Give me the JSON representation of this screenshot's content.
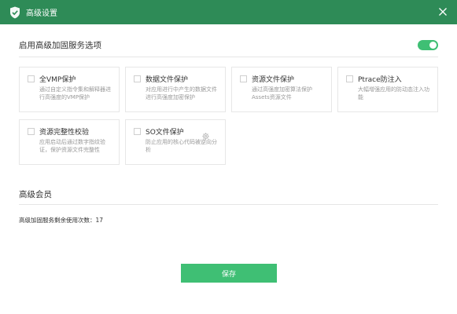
{
  "window": {
    "title": "高级设置",
    "title_color": "#2e8b57",
    "accent_color": "#3fbf74",
    "icon": "shield-check-icon",
    "close_icon": "close-icon"
  },
  "reinforce": {
    "header": "启用高级加固服务选项",
    "toggle_on": true,
    "options": [
      {
        "name": "全VMP保护",
        "desc": "通过自定义指令集和解释器进行高强度的VMP保护",
        "checked": false
      },
      {
        "name": "数据文件保护",
        "desc": "对应用进行中产生的数据文件进行高强度加密保护",
        "checked": false
      },
      {
        "name": "资源文件保护",
        "desc": "通过高强度加密算法保护Assets资源文件",
        "checked": false
      },
      {
        "name": "Ptrace防注入",
        "desc": "大幅增强应用的防动态注入功能",
        "checked": false
      },
      {
        "name": "资源完整性校验",
        "desc": "应用启动后通过数字指纹验证，保护资源文件完整性",
        "checked": false
      },
      {
        "name": "SO文件保护",
        "desc": "防止应用的核心代码被逆向分析",
        "checked": false,
        "settings_icon": "gear-icon"
      }
    ]
  },
  "member": {
    "header": "高级会员",
    "usage_label": "高级加固服务剩余使用次数：",
    "usage_count": "17"
  },
  "save_label": "保存"
}
